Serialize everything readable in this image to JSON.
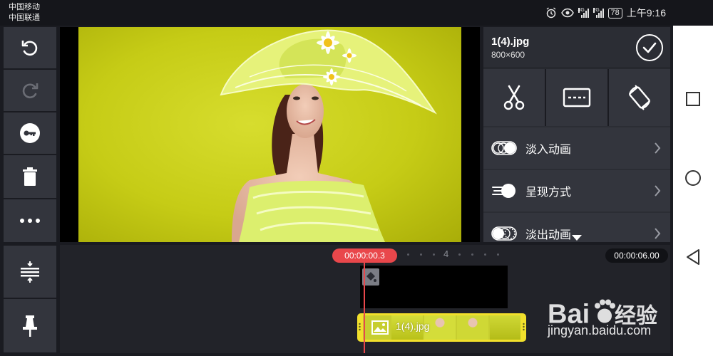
{
  "status_bar": {
    "carrier_1": "中国移动",
    "carrier_2": "中国联通",
    "net_1": "4G",
    "net_2": "2G",
    "battery": "78",
    "time": "上午9:16"
  },
  "toolbar": {
    "undo": "undo-icon",
    "redo": "redo-icon",
    "keyframe": "key-icon",
    "delete": "trash-icon",
    "more": "more-icon",
    "layers": "layers-adjust-icon",
    "pin": "pin-icon"
  },
  "panel": {
    "file_name": "1(4).jpg",
    "file_dim": "800×600",
    "rows": [
      {
        "label": "淡入动画",
        "icon": "fade-in-icon"
      },
      {
        "label": "呈现方式",
        "icon": "display-mode-icon"
      },
      {
        "label": "淡出动画",
        "icon": "fade-out-icon"
      }
    ]
  },
  "timeline": {
    "current_time": "00:00:00.3",
    "total_time": "00:00:06.00",
    "ruler_mark": "4",
    "clip_label": "1(4).jpg"
  },
  "watermark": {
    "url": "jingyan.baidu.com"
  },
  "colors": {
    "accent_red": "#e9474b",
    "clip_yellow": "#f2e02c",
    "panel_bg": "#33353d",
    "photo_bg": "#c6cc16"
  }
}
